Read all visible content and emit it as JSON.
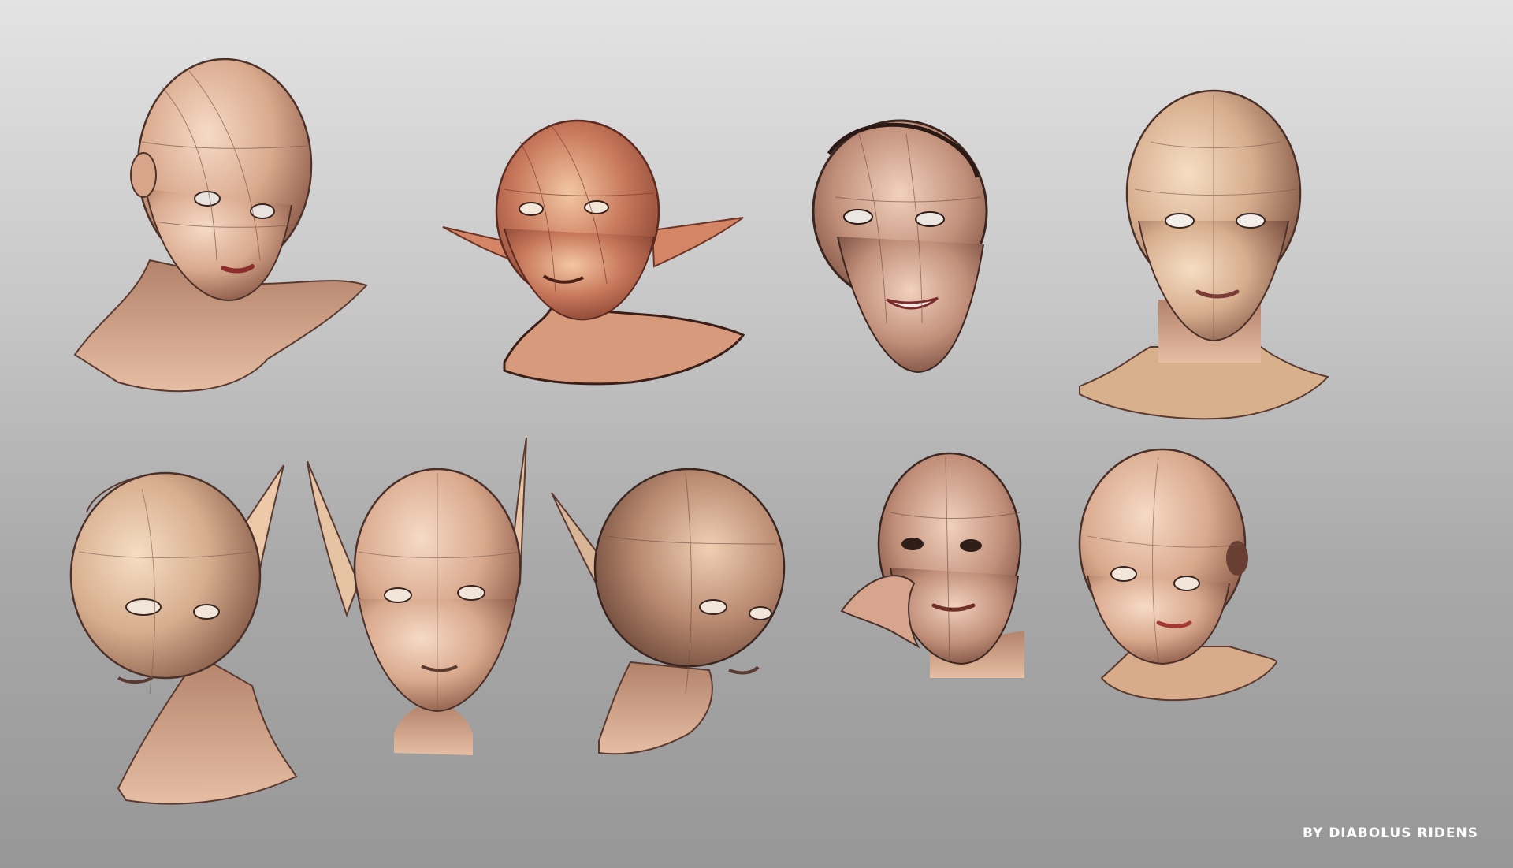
{
  "artwork": {
    "credit": "BY DIABOLUS RIDENS",
    "studies": [
      {
        "label": "bald female head, three-quarter view, ear visible",
        "variant": "round"
      },
      {
        "label": "goblin head with pointed ears",
        "variant": "goblin"
      },
      {
        "label": "smiling female head",
        "variant": "smile"
      },
      {
        "label": "front view head with shoulders",
        "variant": "front"
      },
      {
        "label": "elf head turned left",
        "variant": "elf-left"
      },
      {
        "label": "elf head front view with tall ears",
        "variant": "elf-front"
      },
      {
        "label": "elf head turned right",
        "variant": "elf-right"
      },
      {
        "label": "female head resting on hand",
        "variant": "hand"
      },
      {
        "label": "female head tilted",
        "variant": "tilt"
      }
    ],
    "colors": {
      "skin_light": "#efc9ad",
      "skin_mid": "#c99a7c",
      "skin_dark": "#7a4a3a",
      "goblin": "#b9674c",
      "line": "#5a3a30"
    }
  }
}
